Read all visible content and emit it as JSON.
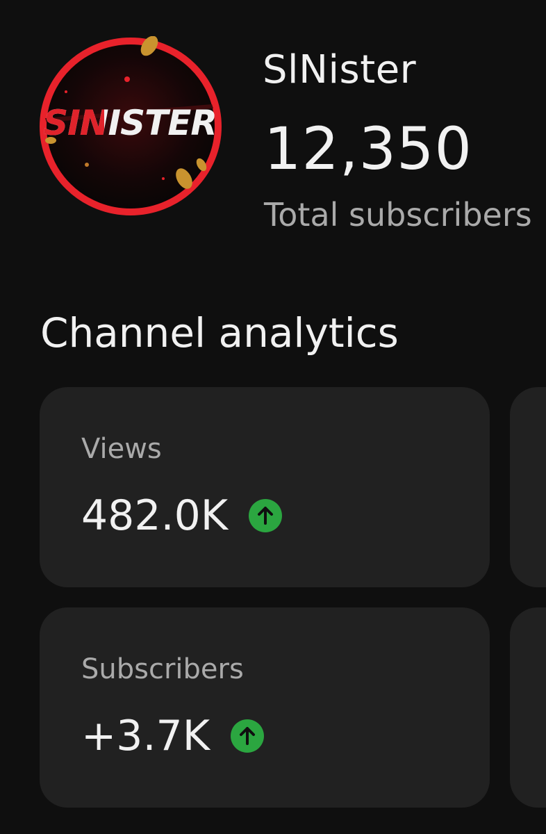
{
  "channel": {
    "name": "SlNister",
    "subscriber_count": "12,350",
    "subscriber_caption": "Total subscribers",
    "avatar": {
      "text": "SINISTER",
      "icon": "channel-avatar-icon",
      "ring_color": "#e8222b",
      "text_accent_color": "#e0232b"
    }
  },
  "analytics": {
    "title": "Channel analytics",
    "cards": [
      {
        "label": "Views",
        "value": "482.0K",
        "trend": "up",
        "trend_icon": "arrow-up-icon"
      },
      {
        "label": "Subscribers",
        "value": "+3.7K",
        "trend": "up",
        "trend_icon": "arrow-up-icon"
      }
    ]
  },
  "colors": {
    "background": "#0f0f0f",
    "card": "#212121",
    "text_primary": "#f1f1f1",
    "text_secondary": "#aaaaaa",
    "trend_up": "#2ba640"
  }
}
